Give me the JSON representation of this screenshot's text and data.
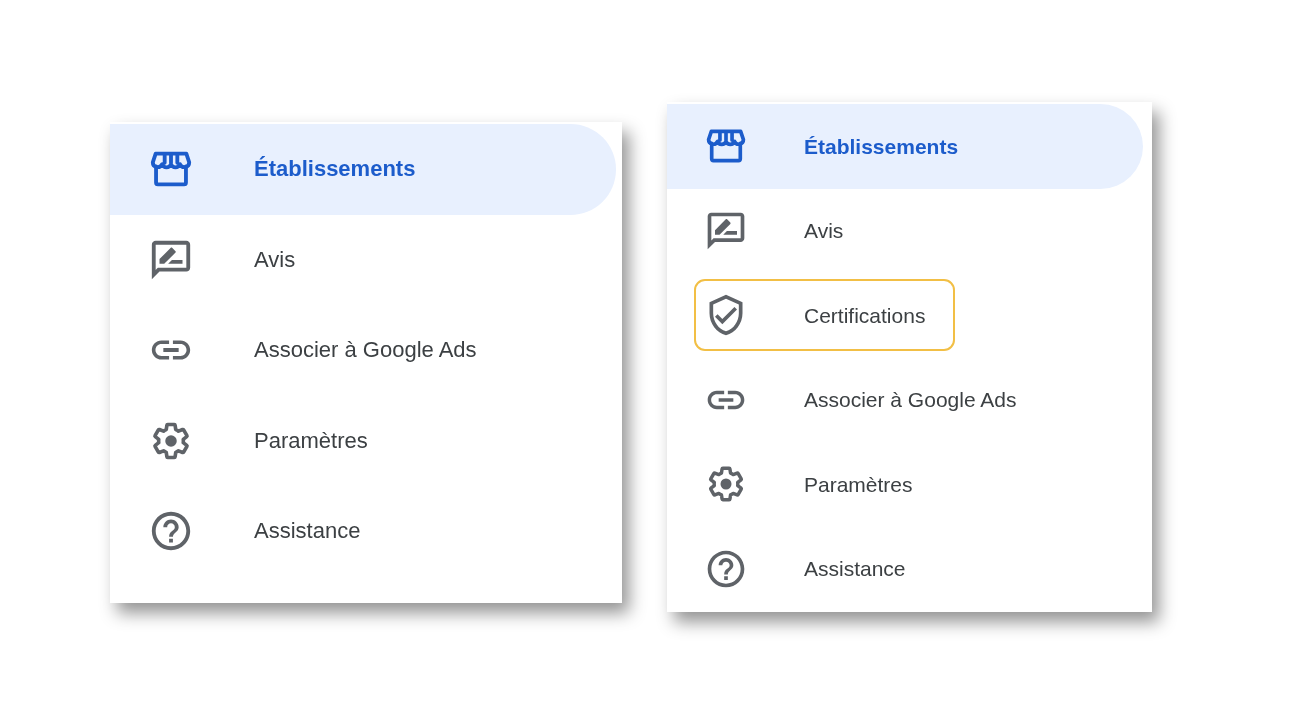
{
  "panels": [
    {
      "items": [
        {
          "kind": "store",
          "label": "Établissements",
          "selected": true
        },
        {
          "kind": "review",
          "label": "Avis",
          "selected": false
        },
        {
          "kind": "link",
          "label": "Associer à Google Ads",
          "selected": false
        },
        {
          "kind": "gear",
          "label": "Paramètres",
          "selected": false
        },
        {
          "kind": "help",
          "label": "Assistance",
          "selected": false
        }
      ]
    },
    {
      "items": [
        {
          "kind": "store",
          "label": "Établissements",
          "selected": true,
          "highlighted": false
        },
        {
          "kind": "review",
          "label": "Avis",
          "selected": false,
          "highlighted": false
        },
        {
          "kind": "shield",
          "label": "Certifications",
          "selected": false,
          "highlighted": true
        },
        {
          "kind": "link",
          "label": "Associer à Google Ads",
          "selected": false,
          "highlighted": false
        },
        {
          "kind": "gear",
          "label": "Paramètres",
          "selected": false,
          "highlighted": false
        },
        {
          "kind": "help",
          "label": "Assistance",
          "selected": false,
          "highlighted": false
        }
      ]
    }
  ]
}
